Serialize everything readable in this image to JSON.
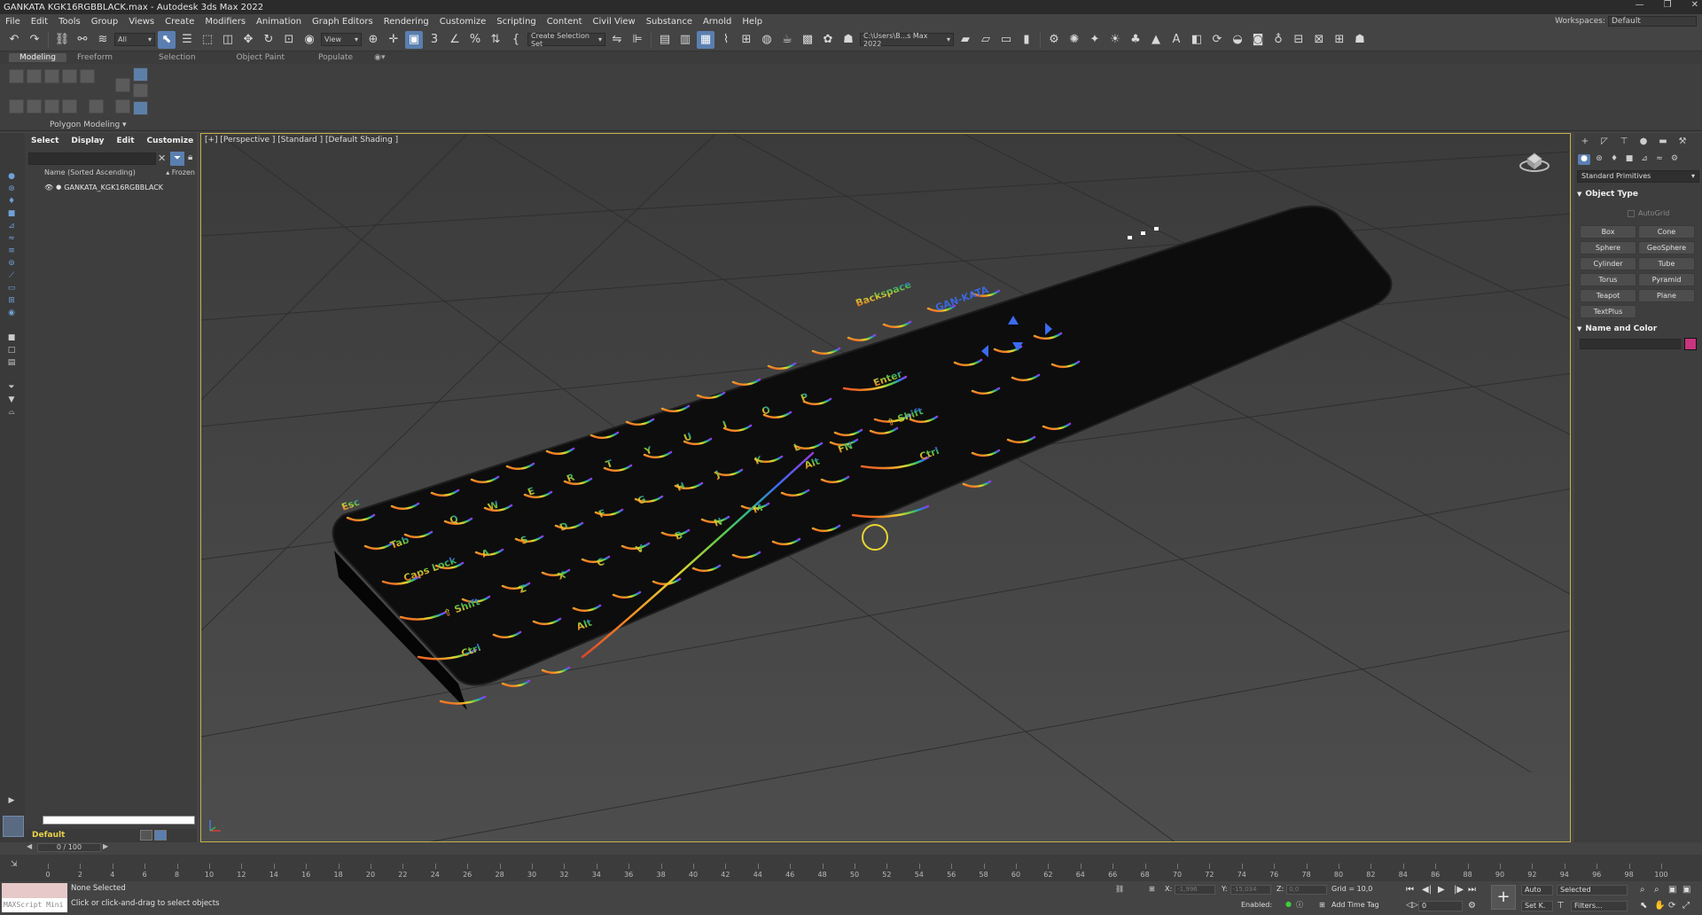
{
  "window": {
    "title": "GANKATA KGK16RGBBLACK.max - Autodesk 3ds Max 2022",
    "controls": [
      "—",
      "❐",
      "✕"
    ]
  },
  "menu": {
    "items": [
      "File",
      "Edit",
      "Tools",
      "Group",
      "Views",
      "Create",
      "Modifiers",
      "Animation",
      "Graph Editors",
      "Rendering",
      "Customize",
      "Scripting",
      "Content",
      "Civil View",
      "Substance",
      "Arnold",
      "Help"
    ],
    "workspace_label": "Workspaces:",
    "workspace_value": "Default"
  },
  "toolbar": {
    "filter_value": "All",
    "view_value": "View",
    "selection_set_placeholder": "Create Selection Set",
    "path_value": "C:\\Users\\B...s Max 2022"
  },
  "ribbon": {
    "tabs": [
      "Modeling",
      "Freeform",
      "Selection",
      "Object Paint",
      "Populate"
    ],
    "panel_label": "Polygon Modeling"
  },
  "scene_explorer": {
    "tabs": [
      "Select",
      "Display",
      "Edit",
      "Customize"
    ],
    "column_header": "Name (Sorted Ascending)",
    "frozen_label": "▴ Frozen",
    "objects": [
      "GANKATA_KGK16RGBBLACK"
    ]
  },
  "layer": {
    "name": "Default"
  },
  "viewport": {
    "label": "[+] [Perspective ] [Standard ] [Default Shading ]"
  },
  "command_panel": {
    "category": "Standard Primitives",
    "object_type_title": "Object Type",
    "autogrid_label": "AutoGrid",
    "primitives": [
      "Box",
      "Cone",
      "Sphere",
      "GeoSphere",
      "Cylinder",
      "Tube",
      "Torus",
      "Pyramid",
      "Teapot",
      "Plane",
      "TextPlus"
    ],
    "name_color_title": "Name and Color",
    "object_color": "#c8347f"
  },
  "timeline": {
    "frame_display": "0 / 100",
    "ticks": [
      0,
      2,
      4,
      6,
      8,
      10,
      12,
      14,
      16,
      18,
      20,
      22,
      24,
      26,
      28,
      30,
      32,
      34,
      36,
      38,
      40,
      42,
      44,
      46,
      48,
      50,
      52,
      54,
      56,
      58,
      60,
      62,
      64,
      66,
      68,
      70,
      72,
      74,
      76,
      78,
      80,
      82,
      84,
      86,
      88,
      90,
      92,
      94,
      96,
      98,
      100
    ]
  },
  "status": {
    "maxscript_label": "MAXScript Mini",
    "selection": "None Selected",
    "prompt": "Click or click-and-drag to select objects",
    "x_label": "X:",
    "x_value": "-1,996",
    "y_label": "Y:",
    "y_value": "-15,034",
    "z_label": "Z:",
    "z_value": "0,0",
    "grid": "Grid = 10,0",
    "enabled_label": "Enabled:",
    "add_time_tag": "Add Time Tag",
    "auto_label": "Auto",
    "setkey_label": "Set K.",
    "selected_value": "Selected",
    "filters_label": "Filters...",
    "current_frame": "0"
  }
}
